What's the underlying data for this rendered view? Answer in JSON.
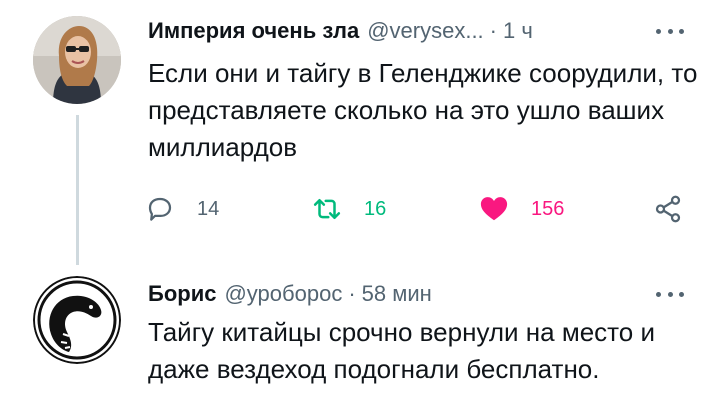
{
  "tweet1": {
    "author_name": "Империя очень зла",
    "handle": "@verysex...",
    "separator": "·",
    "time": "1 ч",
    "text": "Если они и тайгу в Геленджике соорудили, то представляете сколько на это ушло ваших миллиардов",
    "reply_count": "14",
    "retweet_count": "16",
    "like_count": "156",
    "liked": true
  },
  "tweet2": {
    "author_name": "Борис",
    "handle": "@уроборос",
    "separator": "·",
    "time": "58 мин",
    "text": "Тайгу китайцы срочно вернули на место и даже вездеход подогнали бесплатно."
  },
  "icons": {
    "reply": "reply-icon",
    "retweet": "retweet-icon",
    "like": "heart-icon",
    "share": "share-icon",
    "more": "more-icon"
  },
  "colors": {
    "text": "#0f1419",
    "secondary": "#536471",
    "retweet": "#00ba7c",
    "like": "#f91880",
    "thread_line": "#cfd9de"
  }
}
